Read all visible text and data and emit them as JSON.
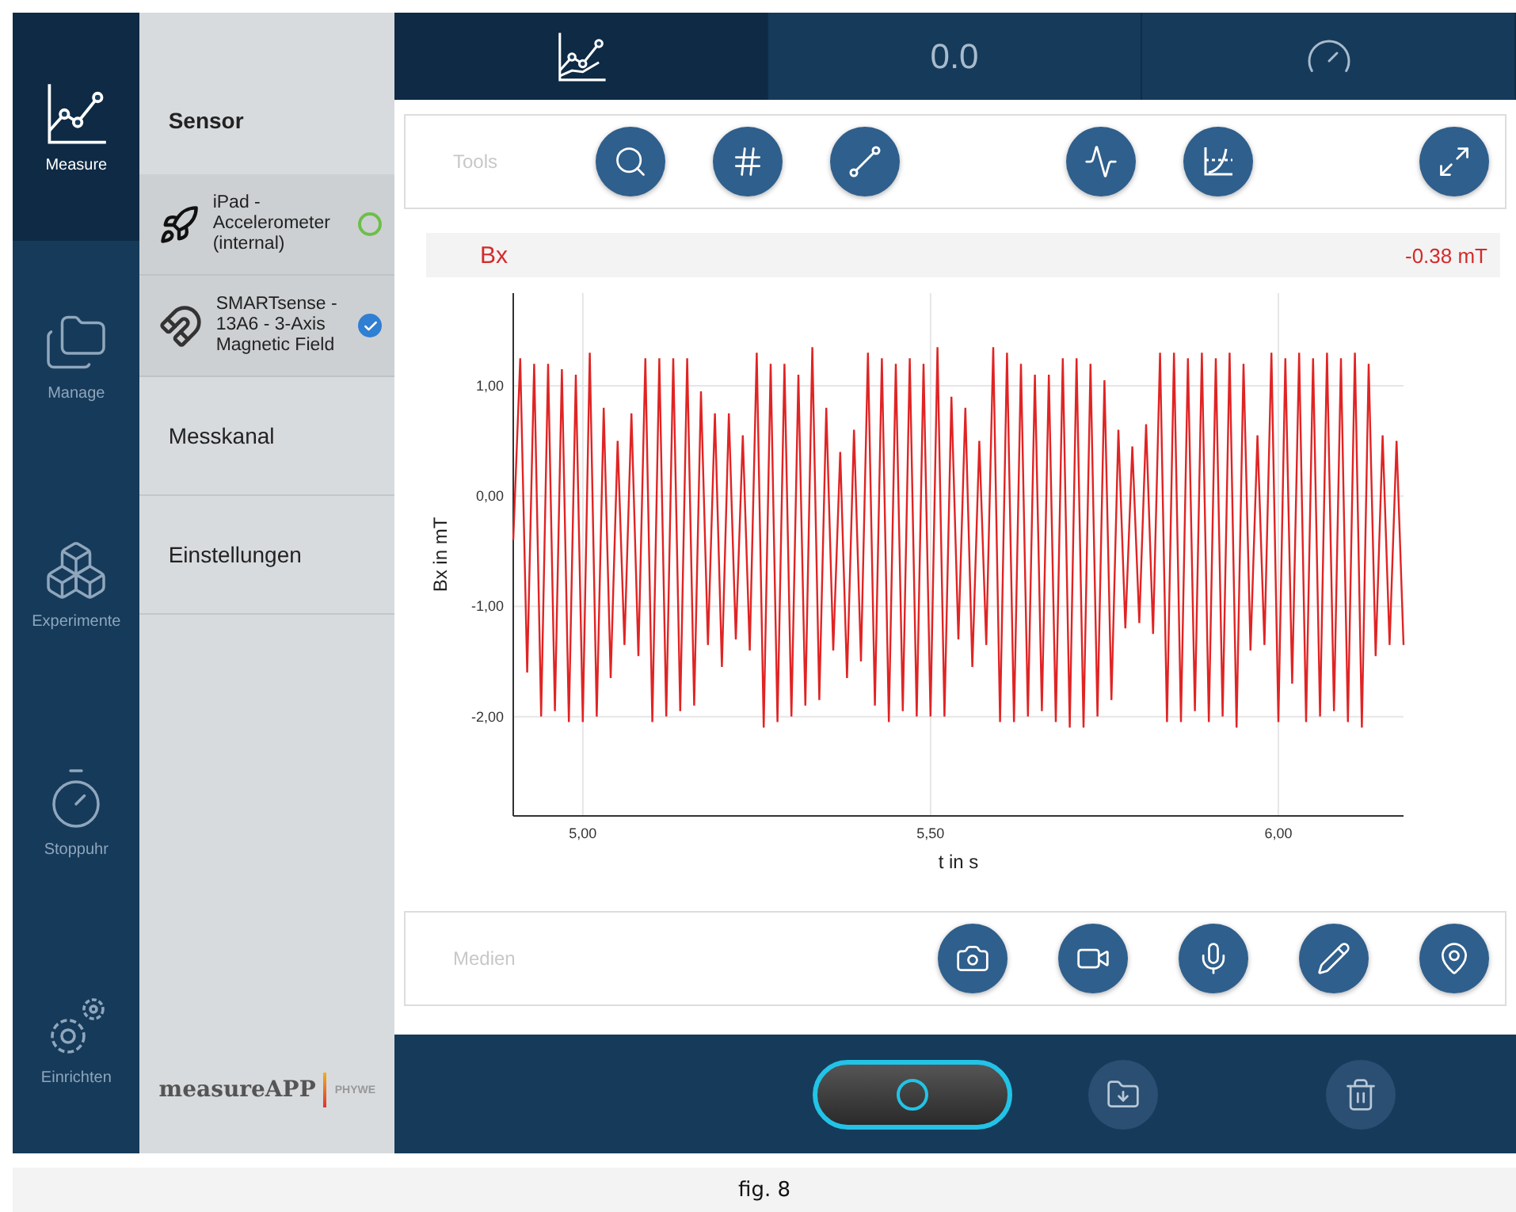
{
  "nav": [
    {
      "label": "Measure",
      "selected": true
    },
    {
      "label": "Manage",
      "selected": false
    },
    {
      "label": "Experimente",
      "selected": false
    },
    {
      "label": "Stoppuhr",
      "selected": false
    },
    {
      "label": "Einrichten",
      "selected": false
    }
  ],
  "panel": {
    "heading": "Sensor",
    "sensors": [
      {
        "name": "iPad - Accelerometer (internal)",
        "selected": false
      },
      {
        "name": "SMARTsense - 13A6 - 3-Axis Magnetic Field",
        "selected": true
      }
    ],
    "sections": [
      "Messkanal",
      "Einstellungen"
    ],
    "logo": {
      "name": "measureAPP",
      "brand": "PHYWE"
    }
  },
  "tabs": [
    {
      "kind": "graph",
      "selected": true
    },
    {
      "kind": "text",
      "label": "0.0",
      "selected": false
    },
    {
      "kind": "gauge",
      "selected": false
    }
  ],
  "tools": {
    "label": "Tools"
  },
  "channel": {
    "reading": "-0.38 mT"
  },
  "chart_data": {
    "type": "line",
    "xlabel": "t in s",
    "ylabel": "Bx in mT",
    "grid": true,
    "xlim": [
      4.9,
      6.18
    ],
    "ylim": [
      -2.9,
      1.84
    ],
    "xticks": [
      {
        "value": 5,
        "label": "5,00"
      },
      {
        "value": 5.5,
        "label": "5,50"
      },
      {
        "value": 6,
        "label": "6,00"
      }
    ],
    "yticks": [
      {
        "value": 1,
        "label": "1,00"
      },
      {
        "value": 0,
        "label": "0,00"
      },
      {
        "value": -1,
        "label": "-1,00"
      },
      {
        "value": -2,
        "label": "-2,00"
      }
    ],
    "x": [
      4.9,
      4.91,
      4.92,
      4.93,
      4.94,
      4.95,
      4.96,
      4.97,
      4.98,
      4.99,
      5.0,
      5.01,
      5.02,
      5.03,
      5.04,
      5.05,
      5.06,
      5.07,
      5.08,
      5.09,
      5.1,
      5.11,
      5.12,
      5.13,
      5.14,
      5.15,
      5.16,
      5.17,
      5.18,
      5.19,
      5.2,
      5.21,
      5.22,
      5.23,
      5.24,
      5.25,
      5.26,
      5.27,
      5.28,
      5.29,
      5.3,
      5.31,
      5.32,
      5.33,
      5.34,
      5.35,
      5.36,
      5.37,
      5.38,
      5.39,
      5.4,
      5.41,
      5.42,
      5.43,
      5.44,
      5.45,
      5.46,
      5.47,
      5.48,
      5.49,
      5.5,
      5.51,
      5.52,
      5.53,
      5.54,
      5.55,
      5.56,
      5.57,
      5.58,
      5.59,
      5.6,
      5.61,
      5.62,
      5.63,
      5.64,
      5.65,
      5.66,
      5.67,
      5.68,
      5.69,
      5.7,
      5.71,
      5.72,
      5.73,
      5.74,
      5.75,
      5.76,
      5.77,
      5.78,
      5.79,
      5.8,
      5.81,
      5.82,
      5.83,
      5.84,
      5.85,
      5.86,
      5.87,
      5.88,
      5.89,
      5.9,
      5.91,
      5.92,
      5.93,
      5.94,
      5.95,
      5.96,
      5.97,
      5.98,
      5.99,
      6.0,
      6.01,
      6.02,
      6.03,
      6.04,
      6.05,
      6.06,
      6.07,
      6.08,
      6.09,
      6.1,
      6.11,
      6.12,
      6.13,
      6.14,
      6.15,
      6.16,
      6.17,
      6.18
    ],
    "series": [
      {
        "name": "Bx",
        "color": "#e02424",
        "values": [
          -0.4,
          1.25,
          -1.6,
          1.2,
          -2.0,
          1.2,
          -1.95,
          1.15,
          -2.05,
          1.1,
          -2.05,
          1.3,
          -2.0,
          0.8,
          -1.65,
          0.5,
          -1.35,
          0.75,
          -1.45,
          1.25,
          -2.05,
          1.25,
          -2.0,
          1.25,
          -1.95,
          1.25,
          -1.9,
          0.95,
          -1.35,
          0.75,
          -1.55,
          0.75,
          -1.3,
          0.55,
          -1.4,
          1.3,
          -2.1,
          1.2,
          -2.05,
          1.2,
          -2.0,
          1.1,
          -1.9,
          1.35,
          -1.85,
          0.8,
          -1.4,
          0.4,
          -1.65,
          0.6,
          -1.5,
          1.3,
          -1.9,
          1.25,
          -2.05,
          1.2,
          -1.95,
          1.25,
          -2.0,
          1.2,
          -2.0,
          1.35,
          -2.0,
          0.9,
          -1.3,
          0.8,
          -1.55,
          0.5,
          -1.35,
          1.35,
          -2.05,
          1.3,
          -2.05,
          1.2,
          -2.0,
          1.1,
          -1.95,
          1.1,
          -2.05,
          1.25,
          -2.1,
          1.25,
          -2.1,
          1.2,
          -2.0,
          1.05,
          -1.85,
          0.6,
          -1.2,
          0.45,
          -1.15,
          0.65,
          -1.25,
          1.3,
          -2.05,
          1.3,
          -2.05,
          1.25,
          -1.95,
          1.3,
          -2.05,
          1.25,
          -2.0,
          1.3,
          -2.1,
          1.2,
          -1.4,
          0.55,
          -1.35,
          1.3,
          -2.05,
          1.25,
          -1.7,
          1.3,
          -2.05,
          1.25,
          -2.0,
          1.3,
          -1.95,
          1.25,
          -2.05,
          1.3,
          -2.1,
          1.2,
          -1.45,
          0.55,
          -1.35,
          0.5,
          -1.35
        ]
      }
    ]
  },
  "media": {
    "label": "Medien"
  },
  "actions": {
    "record": {
      "recording": false
    }
  },
  "caption": "fig. 8"
}
